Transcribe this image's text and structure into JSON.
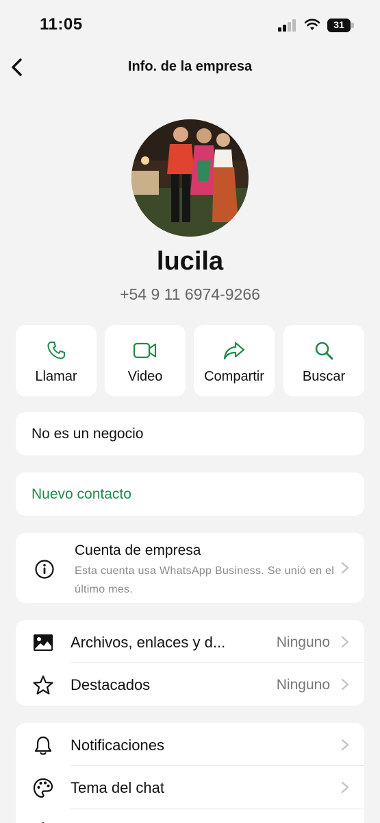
{
  "status": {
    "time": "11:05",
    "battery": "31"
  },
  "header": {
    "title": "Info. de la empresa"
  },
  "profile": {
    "name": "lucila",
    "phone": "+54 9 11 6974-9266"
  },
  "actions": [
    {
      "label": "Llamar",
      "icon": "phone-icon"
    },
    {
      "label": "Video",
      "icon": "video-icon"
    },
    {
      "label": "Compartir",
      "icon": "share-icon"
    },
    {
      "label": "Buscar",
      "icon": "search-icon"
    }
  ],
  "business_notice": {
    "label": "No es un negocio"
  },
  "new_contact": {
    "label": "Nuevo contacto"
  },
  "business_account": {
    "title": "Cuenta de empresa",
    "subtitle": "Esta cuenta usa WhatsApp Business. Se unió en el último mes."
  },
  "media_section": {
    "media": {
      "label": "Archivos, enlaces y d...",
      "value": "Ninguno"
    },
    "starred": {
      "label": "Destacados",
      "value": "Ninguno"
    }
  },
  "settings_section": {
    "notifications": {
      "label": "Notificaciones"
    },
    "chat_theme": {
      "label": "Tema del chat"
    }
  },
  "colors": {
    "accent": "#1f8a4c",
    "background": "#f3f3f3",
    "card": "#ffffff"
  }
}
